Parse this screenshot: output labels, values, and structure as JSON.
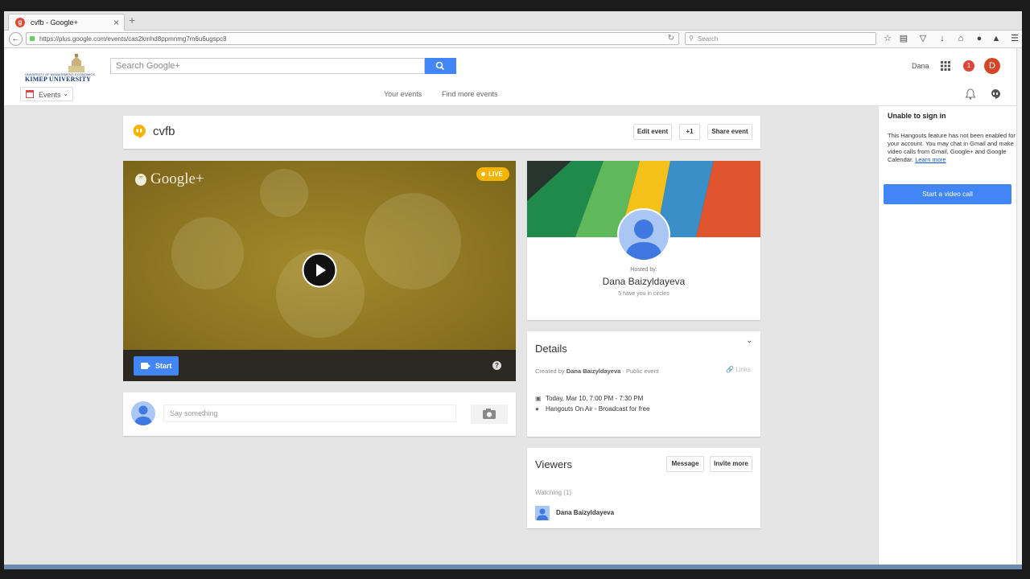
{
  "browser": {
    "tab_title": "cvfb - Google+",
    "tab_favicon": "g",
    "tab_close": "×",
    "new_tab": "+",
    "url": "https://plus.google.com/events/cas2kmhd8ppmnmg7m6u6ugspc8",
    "search_placeholder": "Search"
  },
  "header": {
    "logo_line1": "UNIVERSITY OF MANAGEMENT, ECONOMICS",
    "logo_line2": "KIMEP UNIVERSITY",
    "search_placeholder": "Search Google+",
    "user_name": "Dana",
    "notifications": "1",
    "avatar_letter": "D"
  },
  "subnav": {
    "dropdown_label": "Events",
    "links": [
      "Your events",
      "Find more events"
    ]
  },
  "event": {
    "title": "cvfb",
    "buttons": {
      "edit": "Edit event",
      "plus_one": "+1",
      "share": "Share event"
    }
  },
  "video": {
    "brand": "Google+",
    "live_label": "LIVE",
    "start_label": "Start",
    "help": "?"
  },
  "comment": {
    "placeholder": "Say something"
  },
  "host": {
    "hosted_by_label": "Hosted by:",
    "name": "Dana Baizyldayeva",
    "circles": "5 have you in circles"
  },
  "details": {
    "title": "Details",
    "created_by_label": "Created by",
    "creator": "Dana Baizyldayeva",
    "visibility": "· Public event",
    "links_label": "Links",
    "date": "Today, Mar 10, 7:00 PM - 7:30 PM",
    "location": "Hangouts On Air - Broadcast for free"
  },
  "viewers": {
    "title": "Viewers",
    "message_button": "Message",
    "invite_button": "Invite more",
    "watching_label": "Watching (1)",
    "viewer_name": "Dana Baizyldayeva"
  },
  "hangouts_panel": {
    "title": "Unable to sign in",
    "body": "This Hangouts feature has not been enabled for your account. You may chat in Gmail and make video calls from Gmail, Google+ and Google Calendar.",
    "learn_more": "Learn more",
    "video_call_button": "Start a video call"
  },
  "colors": {
    "accent_blue": "#4285f4",
    "live_yellow": "#f4b400",
    "notification_red": "#db4437"
  }
}
